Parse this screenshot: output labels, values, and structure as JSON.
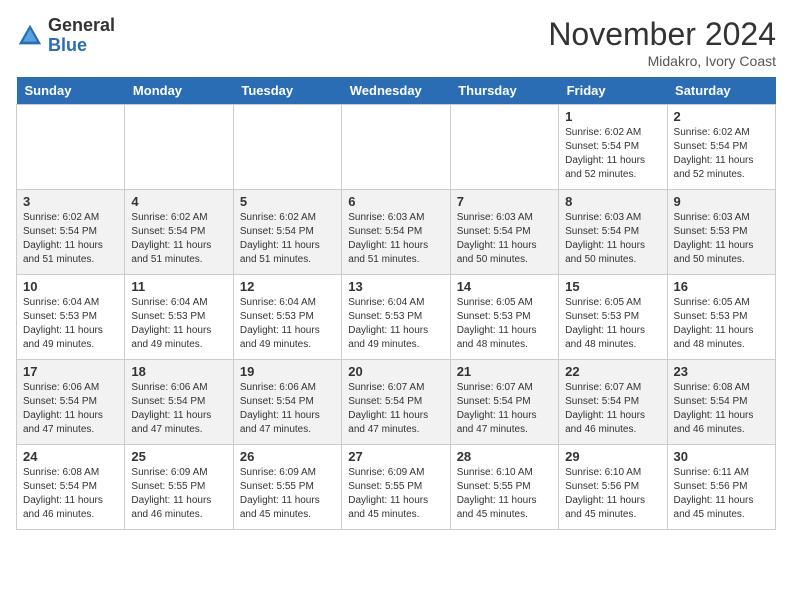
{
  "header": {
    "logo_line1": "General",
    "logo_line2": "Blue",
    "month_year": "November 2024",
    "location": "Midakro, Ivory Coast"
  },
  "weekdays": [
    "Sunday",
    "Monday",
    "Tuesday",
    "Wednesday",
    "Thursday",
    "Friday",
    "Saturday"
  ],
  "weeks": [
    [
      {
        "day": "",
        "info": ""
      },
      {
        "day": "",
        "info": ""
      },
      {
        "day": "",
        "info": ""
      },
      {
        "day": "",
        "info": ""
      },
      {
        "day": "",
        "info": ""
      },
      {
        "day": "1",
        "info": "Sunrise: 6:02 AM\nSunset: 5:54 PM\nDaylight: 11 hours\nand 52 minutes."
      },
      {
        "day": "2",
        "info": "Sunrise: 6:02 AM\nSunset: 5:54 PM\nDaylight: 11 hours\nand 52 minutes."
      }
    ],
    [
      {
        "day": "3",
        "info": "Sunrise: 6:02 AM\nSunset: 5:54 PM\nDaylight: 11 hours\nand 51 minutes."
      },
      {
        "day": "4",
        "info": "Sunrise: 6:02 AM\nSunset: 5:54 PM\nDaylight: 11 hours\nand 51 minutes."
      },
      {
        "day": "5",
        "info": "Sunrise: 6:02 AM\nSunset: 5:54 PM\nDaylight: 11 hours\nand 51 minutes."
      },
      {
        "day": "6",
        "info": "Sunrise: 6:03 AM\nSunset: 5:54 PM\nDaylight: 11 hours\nand 51 minutes."
      },
      {
        "day": "7",
        "info": "Sunrise: 6:03 AM\nSunset: 5:54 PM\nDaylight: 11 hours\nand 50 minutes."
      },
      {
        "day": "8",
        "info": "Sunrise: 6:03 AM\nSunset: 5:54 PM\nDaylight: 11 hours\nand 50 minutes."
      },
      {
        "day": "9",
        "info": "Sunrise: 6:03 AM\nSunset: 5:53 PM\nDaylight: 11 hours\nand 50 minutes."
      }
    ],
    [
      {
        "day": "10",
        "info": "Sunrise: 6:04 AM\nSunset: 5:53 PM\nDaylight: 11 hours\nand 49 minutes."
      },
      {
        "day": "11",
        "info": "Sunrise: 6:04 AM\nSunset: 5:53 PM\nDaylight: 11 hours\nand 49 minutes."
      },
      {
        "day": "12",
        "info": "Sunrise: 6:04 AM\nSunset: 5:53 PM\nDaylight: 11 hours\nand 49 minutes."
      },
      {
        "day": "13",
        "info": "Sunrise: 6:04 AM\nSunset: 5:53 PM\nDaylight: 11 hours\nand 49 minutes."
      },
      {
        "day": "14",
        "info": "Sunrise: 6:05 AM\nSunset: 5:53 PM\nDaylight: 11 hours\nand 48 minutes."
      },
      {
        "day": "15",
        "info": "Sunrise: 6:05 AM\nSunset: 5:53 PM\nDaylight: 11 hours\nand 48 minutes."
      },
      {
        "day": "16",
        "info": "Sunrise: 6:05 AM\nSunset: 5:53 PM\nDaylight: 11 hours\nand 48 minutes."
      }
    ],
    [
      {
        "day": "17",
        "info": "Sunrise: 6:06 AM\nSunset: 5:54 PM\nDaylight: 11 hours\nand 47 minutes."
      },
      {
        "day": "18",
        "info": "Sunrise: 6:06 AM\nSunset: 5:54 PM\nDaylight: 11 hours\nand 47 minutes."
      },
      {
        "day": "19",
        "info": "Sunrise: 6:06 AM\nSunset: 5:54 PM\nDaylight: 11 hours\nand 47 minutes."
      },
      {
        "day": "20",
        "info": "Sunrise: 6:07 AM\nSunset: 5:54 PM\nDaylight: 11 hours\nand 47 minutes."
      },
      {
        "day": "21",
        "info": "Sunrise: 6:07 AM\nSunset: 5:54 PM\nDaylight: 11 hours\nand 47 minutes."
      },
      {
        "day": "22",
        "info": "Sunrise: 6:07 AM\nSunset: 5:54 PM\nDaylight: 11 hours\nand 46 minutes."
      },
      {
        "day": "23",
        "info": "Sunrise: 6:08 AM\nSunset: 5:54 PM\nDaylight: 11 hours\nand 46 minutes."
      }
    ],
    [
      {
        "day": "24",
        "info": "Sunrise: 6:08 AM\nSunset: 5:54 PM\nDaylight: 11 hours\nand 46 minutes."
      },
      {
        "day": "25",
        "info": "Sunrise: 6:09 AM\nSunset: 5:55 PM\nDaylight: 11 hours\nand 46 minutes."
      },
      {
        "day": "26",
        "info": "Sunrise: 6:09 AM\nSunset: 5:55 PM\nDaylight: 11 hours\nand 45 minutes."
      },
      {
        "day": "27",
        "info": "Sunrise: 6:09 AM\nSunset: 5:55 PM\nDaylight: 11 hours\nand 45 minutes."
      },
      {
        "day": "28",
        "info": "Sunrise: 6:10 AM\nSunset: 5:55 PM\nDaylight: 11 hours\nand 45 minutes."
      },
      {
        "day": "29",
        "info": "Sunrise: 6:10 AM\nSunset: 5:56 PM\nDaylight: 11 hours\nand 45 minutes."
      },
      {
        "day": "30",
        "info": "Sunrise: 6:11 AM\nSunset: 5:56 PM\nDaylight: 11 hours\nand 45 minutes."
      }
    ]
  ]
}
